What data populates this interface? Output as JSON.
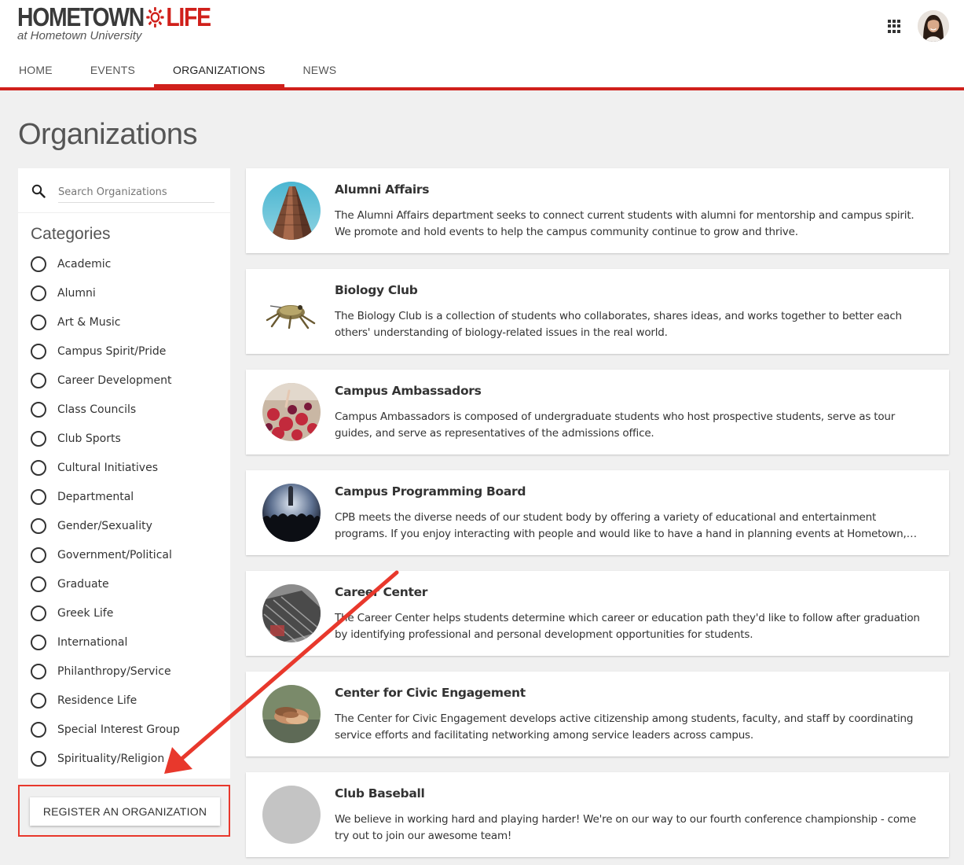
{
  "brand": {
    "logo_primary": "HOMETOWN",
    "logo_accent": "LIFE",
    "logo_sub": "at Hometown University",
    "accent_color": "#d0201b"
  },
  "header": {
    "apps_icon": "apps-grid-icon",
    "avatar": "user-avatar"
  },
  "nav": {
    "tabs": [
      {
        "label": "HOME",
        "active": false
      },
      {
        "label": "EVENTS",
        "active": false
      },
      {
        "label": "ORGANIZATIONS",
        "active": true
      },
      {
        "label": "NEWS",
        "active": false
      }
    ]
  },
  "page": {
    "title": "Organizations"
  },
  "sidebar": {
    "search_placeholder": "Search Organizations",
    "search_value": "",
    "categories_title": "Categories",
    "categories": [
      "Academic",
      "Alumni",
      "Art & Music",
      "Campus Spirit/Pride",
      "Career Development",
      "Class Councils",
      "Club Sports",
      "Cultural Initiatives",
      "Departmental",
      "Gender/Sexuality",
      "Government/Political",
      "Graduate",
      "Greek Life",
      "International",
      "Philanthropy/Service",
      "Residence Life",
      "Special Interest Group",
      "Spirituality/Religion"
    ],
    "register_label": "REGISTER AN ORGANIZATION"
  },
  "organizations": [
    {
      "name": "Alumni Affairs",
      "description": "The Alumni Affairs department seeks to connect current students with alumni for mentorship and campus spirit. We promote and hold events to help the campus community continue to grow and thrive."
    },
    {
      "name": "Biology Club",
      "description": "The Biology Club is a collection of students who collaborates, shares ideas, and works together to better each others' understanding of biology-related issues in the real world."
    },
    {
      "name": "Campus Ambassadors",
      "description": "Campus Ambassadors is composed of undergraduate students who host prospective students, serve as tour guides, and serve as representatives of the admissions office."
    },
    {
      "name": "Campus Programming Board",
      "description": "CPB meets the diverse needs of our student body by offering a variety of educational and entertainment programs. If you enjoy interacting with people and would like to have a hand in planning events at Hometown, we'd love to have you join us."
    },
    {
      "name": "Career Center",
      "description": "The Career Center helps students determine which career or education path they'd like to follow after graduation by identifying professional and personal development opportunities for students."
    },
    {
      "name": "Center for Civic Engagement",
      "description": "The Center for Civic Engagement develops active citizenship among students, faculty, and staff by coordinating service efforts and facilitating networking among service leaders across campus."
    },
    {
      "name": "Club Baseball",
      "description": "We believe in working hard and playing harder! We're on our way to our fourth conference championship - come try out to join our awesome team!"
    }
  ]
}
